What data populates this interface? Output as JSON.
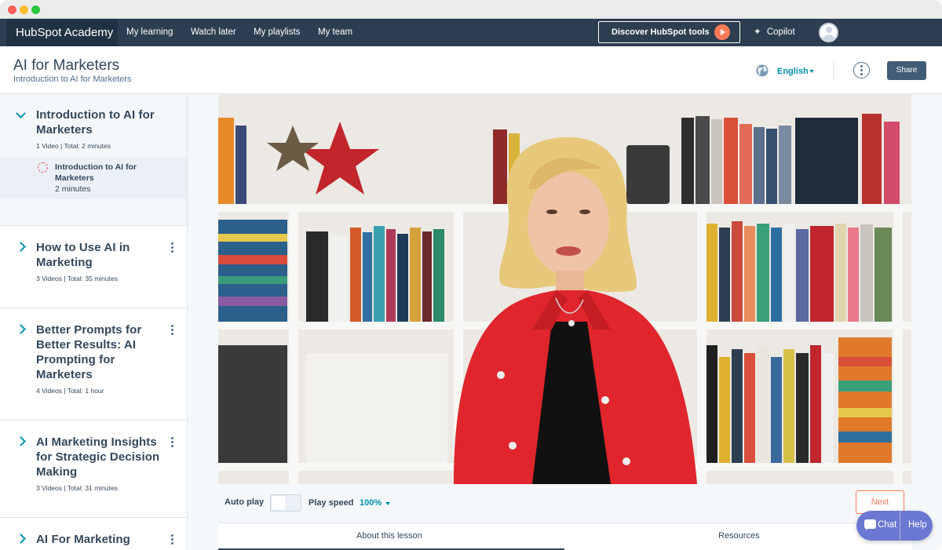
{
  "nav": {
    "brand": "HubSpot Academy",
    "links": [
      "My learning",
      "Watch later",
      "My playlists",
      "My team"
    ],
    "discover_label": "Discover HubSpot tools",
    "copilot_label": "Copilot"
  },
  "header": {
    "title": "AI for Marketers",
    "subtitle": "Introduction to AI for Marketers",
    "language": "English",
    "share_label": "Share"
  },
  "sidebar": {
    "sections": [
      {
        "title": "Introduction to AI for Marketers",
        "meta": "1 Video | Total: 2 minutes",
        "expanded": true
      },
      {
        "title": "How to Use AI in Marketing",
        "meta": "3 Videos | Total: 35 minutes",
        "expanded": false
      },
      {
        "title": "Better Prompts for Better Results: AI Prompting for Marketers",
        "meta": "4 Videos | Total: 1 hour",
        "expanded": false
      },
      {
        "title": "AI Marketing Insights for Strategic Decision Making",
        "meta": "3 Videos | Total: 31 minutes",
        "expanded": false
      },
      {
        "title": "AI For Marketing",
        "meta": "",
        "expanded": false
      }
    ],
    "active_lesson": {
      "title": "Introduction to AI for Marketers",
      "duration": "2 minutes"
    }
  },
  "player": {
    "autoplay_label": "Auto play",
    "autoplay_on": false,
    "speed_label": "Play speed",
    "speed_value": "100%",
    "next_label": "Next"
  },
  "tabs": [
    "About this lesson",
    "Resources"
  ],
  "chat_widget": {
    "chat_label": "Chat",
    "help_label": "Help"
  },
  "colors": {
    "nav_bg": "#2d3e50",
    "accent_teal": "#0091ae",
    "accent_orange": "#ff7a59",
    "chat_purple": "#6a78d1",
    "jacket_red": "#e0262c"
  },
  "icons": [
    "globe-icon",
    "more-options-icon",
    "chevron-down-icon",
    "chevron-right-icon",
    "kebab-menu-icon",
    "play-icon",
    "sparkle-icon",
    "progress-ring-icon",
    "chat-bubble-icon"
  ]
}
